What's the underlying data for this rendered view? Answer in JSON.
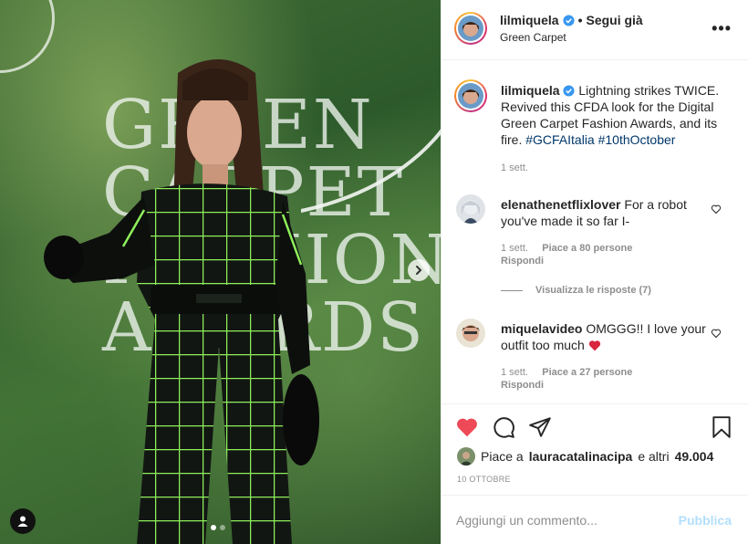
{
  "post": {
    "media": {
      "background_text": [
        "GREEN",
        "CARPET",
        "FASHION",
        "AWARDS"
      ],
      "carousel_count": 2,
      "carousel_index": 0
    },
    "header": {
      "username": "lilmiquela",
      "separator": "•",
      "follow_label": "Segui già",
      "location": "Green Carpet",
      "more_icon": "more-horizontal-icon"
    },
    "caption": {
      "username": "lilmiquela",
      "text": "Lightning strikes TWICE. Revived this CFDA look for the Digital Green Carpet Fashion Awards, and its fire.",
      "hashtags": [
        "#GCFAItalia",
        "#10thOctober"
      ],
      "time": "1 sett."
    },
    "comments": [
      {
        "username": "elenathenetflixlover",
        "text": "For a robot you've made it so far I-",
        "time": "1 sett.",
        "likes": "Piace a 80 persone",
        "reply": "Rispondi",
        "view_replies": "Visualizza le risposte (7)"
      },
      {
        "username": "miquelavideo",
        "text": "OMGGG!! I love your outfit too much",
        "emoji": "heart-emoji",
        "time": "1 sett.",
        "likes": "Piace a 27 persone",
        "reply": "Rispondi"
      }
    ],
    "actions": {
      "liked": true,
      "icons": [
        "heart-icon",
        "comment-icon",
        "share-icon",
        "bookmark-icon"
      ],
      "likes_prefix": "Piace a",
      "likes_user": "lauracatalinacipa",
      "likes_suffix": "e altri",
      "likes_count": "49.004",
      "date": "10 OTTOBRE"
    },
    "add_comment": {
      "placeholder": "Aggiungi un commento...",
      "post_label": "Pubblica"
    },
    "colors": {
      "liked_heart": "#ed4956",
      "hashtag": "#00376b",
      "muted": "#8e8e8e",
      "post_disabled": "#b2dffc",
      "verified": "#3897f0"
    }
  }
}
